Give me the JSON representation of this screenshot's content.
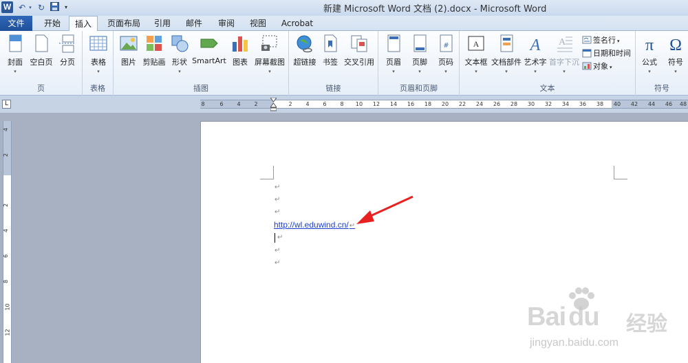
{
  "window": {
    "title": "新建 Microsoft Word 文档 (2).docx - Microsoft Word",
    "app_icon_letter": "W"
  },
  "tabs": [
    {
      "label": "文件"
    },
    {
      "label": "开始"
    },
    {
      "label": "插入"
    },
    {
      "label": "页面布局"
    },
    {
      "label": "引用"
    },
    {
      "label": "邮件"
    },
    {
      "label": "审阅"
    },
    {
      "label": "视图"
    },
    {
      "label": "Acrobat"
    }
  ],
  "active_tab": "插入",
  "ribbon": {
    "groups": {
      "pages": {
        "label": "页",
        "buttons": [
          "封面",
          "空白页",
          "分页"
        ]
      },
      "tables": {
        "label": "表格",
        "buttons": [
          "表格"
        ]
      },
      "illustrations": {
        "label": "插图",
        "buttons": [
          "图片",
          "剪贴画",
          "形状",
          "SmartArt",
          "图表",
          "屏幕截图"
        ]
      },
      "links": {
        "label": "链接",
        "buttons": [
          "超链接",
          "书签",
          "交叉引用"
        ]
      },
      "header_footer": {
        "label": "页眉和页脚",
        "buttons": [
          "页眉",
          "页脚",
          "页码"
        ]
      },
      "text": {
        "label": "文本",
        "buttons": [
          "文本框",
          "文档部件",
          "艺术字",
          "首字下沉"
        ],
        "small": [
          "签名行",
          "日期和时间",
          "对象"
        ]
      },
      "symbols": {
        "label": "符号",
        "buttons": [
          "公式",
          "符号"
        ]
      }
    }
  },
  "ruler": {
    "corner": "L",
    "numbers": [
      "8",
      "6",
      "4",
      "2",
      "2",
      "4",
      "6",
      "8",
      "10",
      "12",
      "14",
      "16",
      "18",
      "20",
      "22",
      "24",
      "26",
      "28",
      "30",
      "32",
      "34",
      "36",
      "38",
      "40",
      "42",
      "44",
      "46",
      "48"
    ],
    "vertical_numbers": [
      "4",
      "2",
      "2",
      "4",
      "6",
      "8",
      "10",
      "12"
    ]
  },
  "document": {
    "hyperlink": "http://wl.eduwind.cn/",
    "paragraph_mark": "↵"
  },
  "watermark": {
    "brand": "Bai",
    "brand_mid": "du",
    "brand_cn": "经验",
    "domain": "jingyan.baidu.com"
  },
  "colors": {
    "file_tab": "#2f67b7",
    "hyperlink": "#1a3fd0",
    "arrow": "#e8201f"
  }
}
